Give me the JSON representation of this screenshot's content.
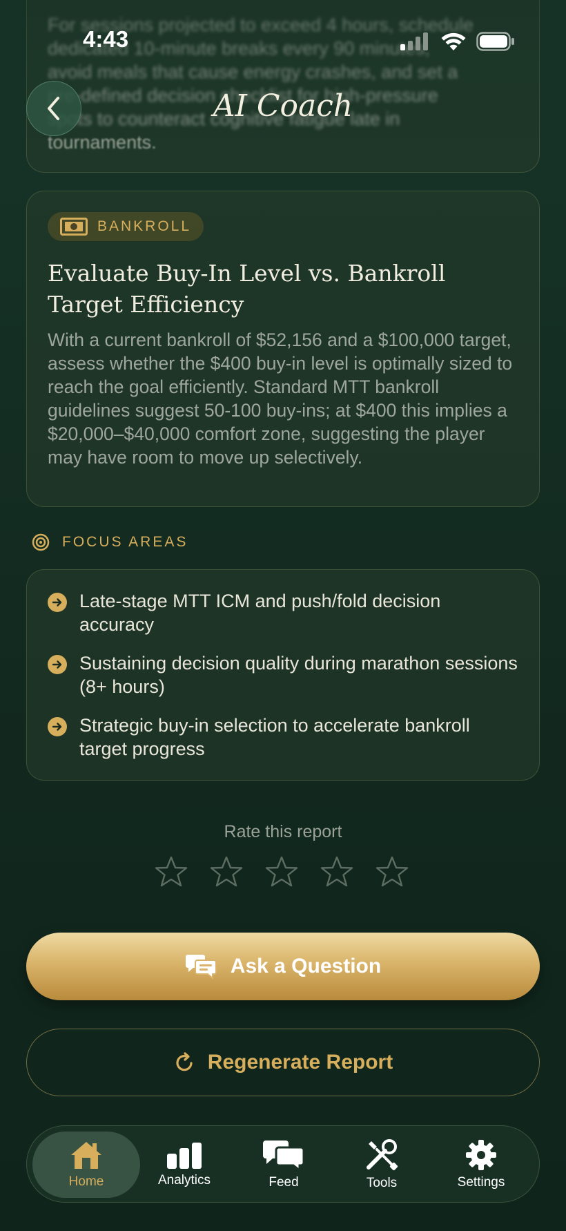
{
  "status_bar": {
    "time": "4:43"
  },
  "header": {
    "title": "AI Coach"
  },
  "previous_card": {
    "lines": [
      "For sessions projected to exceed 4 hours, schedule",
      "dedicated 10-minute breaks every 90 minutes,",
      "avoid meals that cause energy crashes, and set a",
      "pre-defined decision checklist for high-pressure",
      "spots to counteract cognitive fatigue late in"
    ],
    "last_line": "tournaments."
  },
  "bankroll_card": {
    "badge": "BANKROLL",
    "title_line1": "Evaluate Buy-In Level vs. Bankroll",
    "title_line2": "Target Efficiency",
    "body": "With a current bankroll of $52,156 and a $100,000 target, assess whether the $400 buy-in level is optimally sized to reach the goal efficiently. Standard MTT bankroll guidelines suggest 50-100 buy-ins; at $400 this implies a $20,000–$40,000 comfort zone, suggesting the player may have room to move up selectively."
  },
  "focus": {
    "label": "FOCUS AREAS",
    "items": [
      "Late-stage MTT ICM and push/fold decision accuracy",
      "Sustaining decision quality during marathon sessions (8+ hours)",
      "Strategic buy-in selection to accelerate bankroll target progress"
    ]
  },
  "rating": {
    "label": "Rate this report",
    "max_stars": 5,
    "value": 0
  },
  "actions": {
    "ask_label": "Ask a Question",
    "regenerate_label": "Regenerate Report"
  },
  "tabbar": {
    "active": "home",
    "tabs": [
      {
        "id": "home",
        "label": "Home",
        "icon": "house-icon"
      },
      {
        "id": "analytics",
        "label": "Analytics",
        "icon": "bar-chart-icon"
      },
      {
        "id": "feed",
        "label": "Feed",
        "icon": "chat-bubbles-icon"
      },
      {
        "id": "tools",
        "label": "Tools",
        "icon": "wrench-screwdriver-icon"
      },
      {
        "id": "settings",
        "label": "Settings",
        "icon": "gear-icon"
      }
    ]
  },
  "colors": {
    "accent_gold": "#d6ae5c",
    "background": "#12291f",
    "card_border": "#6b7a52"
  }
}
